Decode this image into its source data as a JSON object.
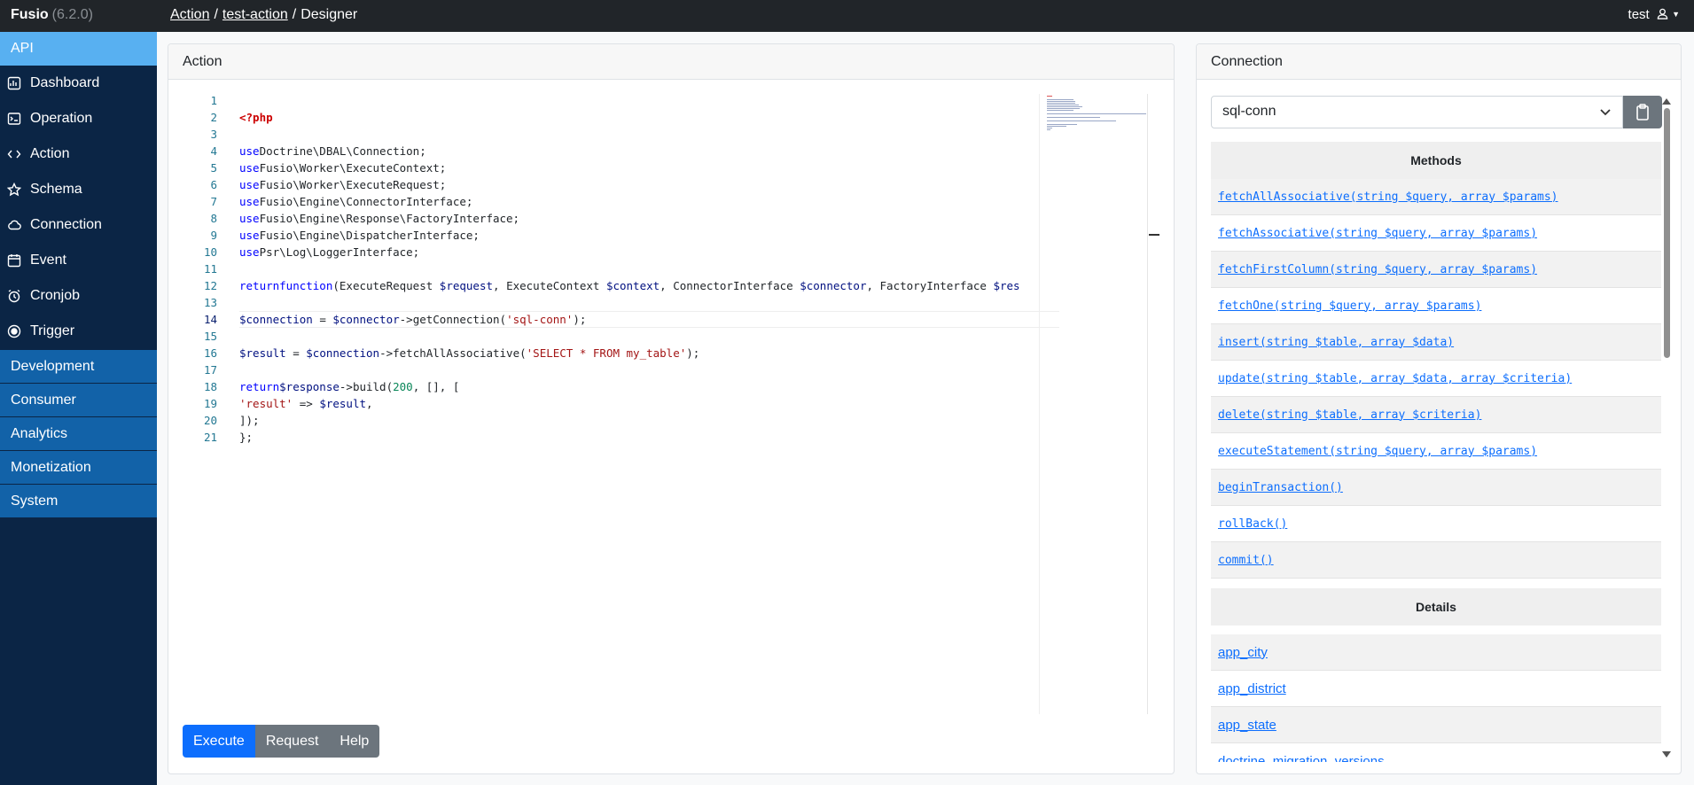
{
  "brand": {
    "name": "Fusio",
    "version": "(6.2.0)"
  },
  "breadcrumb": {
    "item1": "Action",
    "sep": "/",
    "item2": "test-action",
    "item3": "Designer"
  },
  "user": {
    "name": "test"
  },
  "sidebar": {
    "api_header": "API",
    "items": [
      {
        "label": "Dashboard",
        "icon": "dashboard-icon"
      },
      {
        "label": "Operation",
        "icon": "terminal-icon"
      },
      {
        "label": "Action",
        "icon": "code-icon"
      },
      {
        "label": "Schema",
        "icon": "star-icon"
      },
      {
        "label": "Connection",
        "icon": "cloud-icon"
      },
      {
        "label": "Event",
        "icon": "calendar-icon"
      },
      {
        "label": "Cronjob",
        "icon": "alarm-icon"
      },
      {
        "label": "Trigger",
        "icon": "record-icon"
      }
    ],
    "groups": [
      "Development",
      "Consumer",
      "Analytics",
      "Monetization",
      "System"
    ]
  },
  "action_panel": {
    "title": "Action",
    "line_numbers": [
      "1",
      "2",
      "3",
      "4",
      "5",
      "6",
      "7",
      "8",
      "9",
      "10",
      "11",
      "12",
      "13",
      "14",
      "15",
      "16",
      "17",
      "18",
      "19",
      "20",
      "21"
    ],
    "active_line": "14",
    "code": {
      "l1": "<?php",
      "use": "use",
      "l3": "Doctrine\\DBAL\\Connection;",
      "l4": "Fusio\\Worker\\ExecuteContext;",
      "l5": "Fusio\\Worker\\ExecuteRequest;",
      "l6": "Fusio\\Engine\\ConnectorInterface;",
      "l7": "Fusio\\Engine\\Response\\FactoryInterface;",
      "l8": "Fusio\\Engine\\DispatcherInterface;",
      "l9": "Psr\\Log\\LoggerInterface;",
      "l11_return": "return",
      "l11_function": "function",
      "l11_a": "(ExecuteRequest ",
      "l11_req": "$request",
      "l11_b": ", ExecuteContext ",
      "l11_ctx": "$context",
      "l11_c": ", ConnectorInterface ",
      "l11_conn": "$connector",
      "l11_d": ", FactoryInterface ",
      "l11_res": "$res",
      "l13_var": "$connection",
      "l13_eq": " = ",
      "l13_conn": "$connector",
      "l13_call": "->getConnection(",
      "l13_str": "'sql-conn'",
      "l13_end": ");",
      "l15_var": "$result",
      "l15_eq": " = ",
      "l15_conn": "$connection",
      "l15_call": "->fetchAllAssociative(",
      "l15_str": "'SELECT * FROM my_table'",
      "l15_end": ");",
      "l17_return": "return",
      "l17_resp": "$response",
      "l17_call": "->build(",
      "l17_num": "200",
      "l17_end": ", [], [",
      "l18_str": "'result'",
      "l18_arrow": " => ",
      "l18_var": "$result",
      "l18_end": ",",
      "l19": "]);",
      "l20": "};"
    },
    "buttons": {
      "execute": "Execute",
      "request": "Request",
      "help": "Help"
    }
  },
  "connection_panel": {
    "title": "Connection",
    "selected": "sql-conn",
    "methods_header": "Methods",
    "methods": [
      "fetchAllAssociative(string $query, array $params)",
      "fetchAssociative(string $query, array $params)",
      "fetchFirstColumn(string $query, array $params)",
      "fetchOne(string $query, array $params)",
      "insert(string $table, array $data)",
      "update(string $table, array $data, array $criteria)",
      "delete(string $table, array $criteria)",
      "executeStatement(string $query, array $params)",
      "beginTransaction()",
      "rollBack()",
      "commit()"
    ],
    "details_header": "Details",
    "details": [
      "app_city",
      "app_district",
      "app_state",
      "doctrine_migration_versions"
    ]
  }
}
